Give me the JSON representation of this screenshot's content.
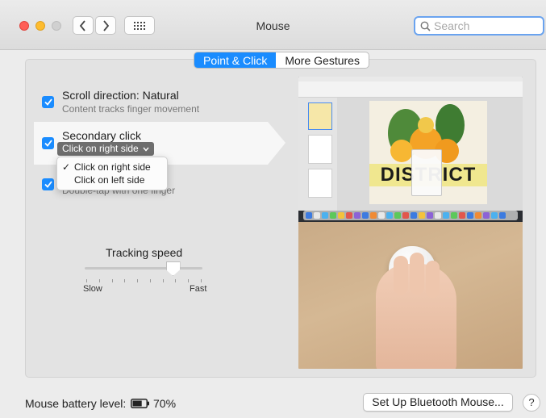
{
  "window": {
    "title": "Mouse",
    "search_placeholder": "Search"
  },
  "toolbar_icons": [
    "back-chevron-icon",
    "forward-chevron-icon",
    "grid-icon",
    "search-icon"
  ],
  "tabs": [
    {
      "label": "Point & Click",
      "active": true
    },
    {
      "label": "More Gestures",
      "active": false
    }
  ],
  "options": {
    "scroll": {
      "title": "Scroll direction: Natural",
      "subtitle": "Content tracks finger movement",
      "checked": true
    },
    "secondary": {
      "title": "Secondary click",
      "selected": "Click on right side",
      "checked": true,
      "menu": [
        {
          "label": "Click on right side",
          "checked": true
        },
        {
          "label": "Click on left side",
          "checked": false
        }
      ]
    },
    "smart_zoom": {
      "subtitle": "Double-tap with one finger",
      "checked": true
    }
  },
  "tracking": {
    "label": "Tracking speed",
    "min_label": "Slow",
    "max_label": "Fast",
    "tick_count": 10,
    "value": 0.75
  },
  "preview": {
    "page_heading": "DISTRICT"
  },
  "footer": {
    "battery_label": "Mouse battery level:",
    "battery_value": "70%",
    "battery_fraction": 0.7,
    "setup_button": "Set Up Bluetooth Mouse...",
    "help_button": "?"
  },
  "colors": {
    "accent": "#1a8cff",
    "close": "#ff5f57",
    "minimize": "#febc2e"
  }
}
